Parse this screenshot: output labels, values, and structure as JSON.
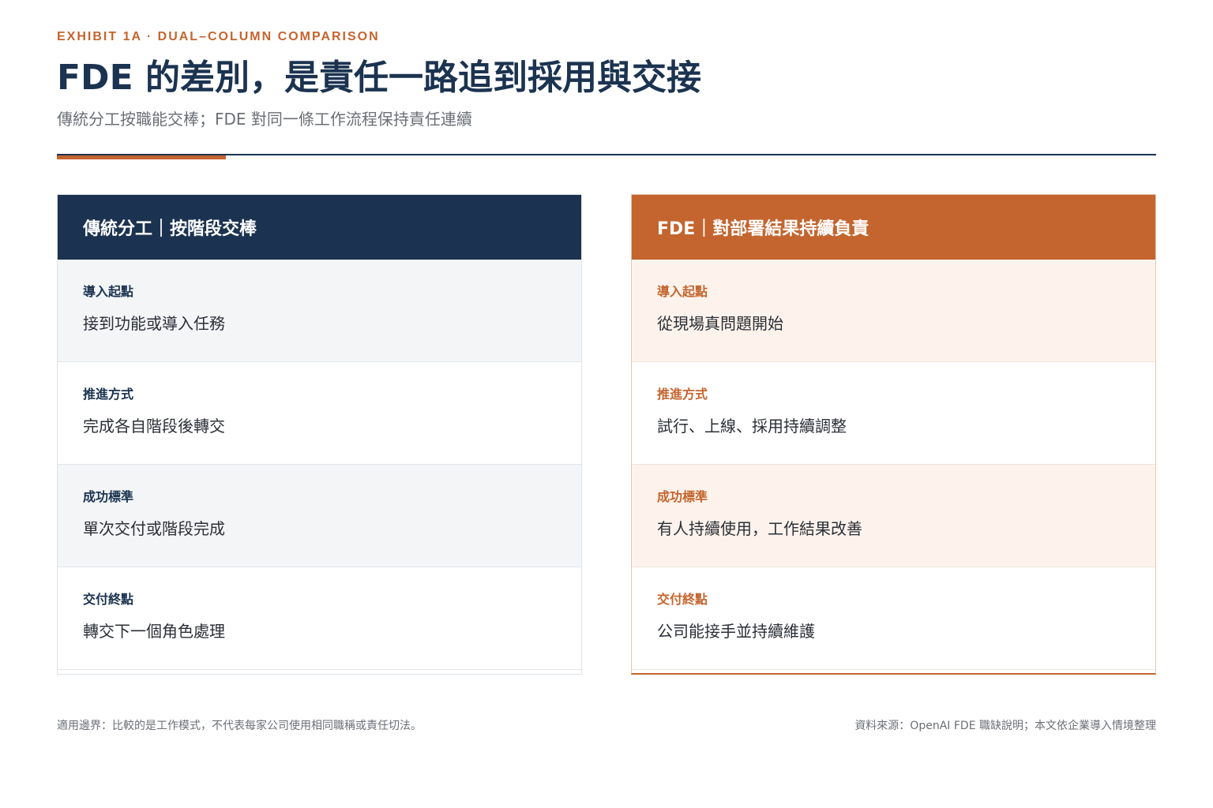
{
  "header": {
    "eyebrow": "EXHIBIT 1A · DUAL–COLUMN COMPARISON",
    "title": "FDE 的差別，是責任一路追到採用與交接",
    "subtitle": "傳統分工按職能交棒；FDE 對同一條工作流程保持責任連續"
  },
  "colors": {
    "navy": "#1b3350",
    "accent": "#c4652f",
    "left_row_tint": "#f3f5f7",
    "right_row_tint": "#fdf3ec"
  },
  "columns": [
    {
      "heading": "傳統分工｜按階段交棒",
      "rows": [
        {
          "label": "導入起點",
          "value": "接到功能或導入任務"
        },
        {
          "label": "推進方式",
          "value": "完成各自階段後轉交"
        },
        {
          "label": "成功標準",
          "value": "單次交付或階段完成"
        },
        {
          "label": "交付終點",
          "value": "轉交下一個角色處理"
        }
      ]
    },
    {
      "heading": "FDE｜對部署結果持續負責",
      "rows": [
        {
          "label": "導入起點",
          "value": "從現場真問題開始"
        },
        {
          "label": "推進方式",
          "value": "試行、上線、採用持續調整"
        },
        {
          "label": "成功標準",
          "value": "有人持續使用，工作結果改善"
        },
        {
          "label": "交付終點",
          "value": "公司能接手並持續維護"
        }
      ]
    }
  ],
  "footer": {
    "scope_note": "適用邊界：比較的是工作模式，不代表每家公司使用相同職稱或責任切法。",
    "source_note": "資料來源：OpenAI FDE 職缺說明；本文依企業導入情境整理"
  }
}
